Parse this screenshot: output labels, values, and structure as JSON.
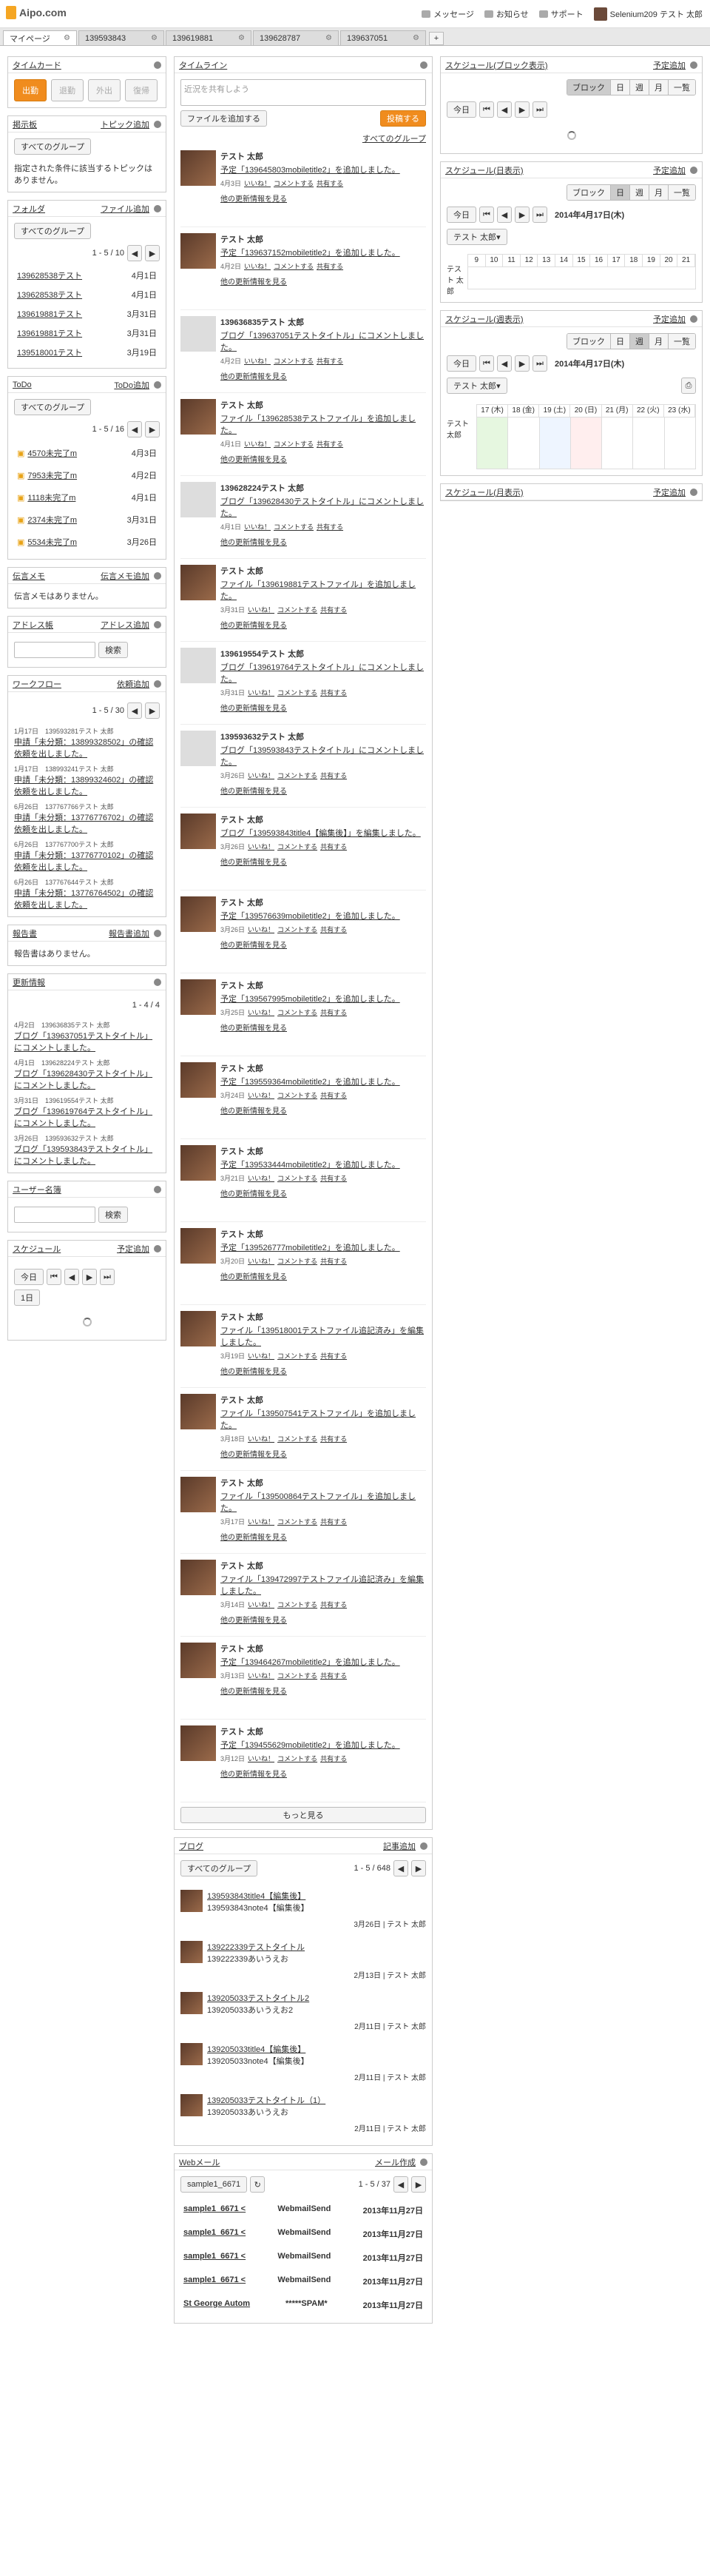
{
  "header": {
    "logo": "Aipo.com",
    "nav": [
      "メッセージ",
      "お知らせ",
      "サポート"
    ],
    "user": "Selenium209 テスト 太郎"
  },
  "tabs": [
    "マイページ",
    "139593843",
    "139619881",
    "139628787",
    "139637051"
  ],
  "left": {
    "timecard": {
      "title": "タイムカード",
      "buttons": [
        "出勤",
        "退勤",
        "外出",
        "復帰"
      ]
    },
    "topic": {
      "title": "掲示板",
      "action": "トピック追加",
      "group": "すべてのグループ",
      "empty": "指定された条件に該当するトピックはありません。"
    },
    "folder": {
      "title": "フォルダ",
      "action": "ファイル追加",
      "group": "すべてのグループ",
      "pager": "1 - 5 / 10",
      "items": [
        {
          "n": "139628538テスト",
          "d": "4月1日"
        },
        {
          "n": "139628538テスト",
          "d": "4月1日"
        },
        {
          "n": "139619881テスト",
          "d": "3月31日"
        },
        {
          "n": "139619881テスト",
          "d": "3月31日"
        },
        {
          "n": "139518001テスト",
          "d": "3月19日"
        }
      ]
    },
    "todo": {
      "title": "ToDo",
      "action": "ToDo追加",
      "group": "すべてのグループ",
      "pager": "1 - 5 / 16",
      "items": [
        {
          "n": "4570未完了m",
          "d": "4月3日"
        },
        {
          "n": "7953未完了m",
          "d": "4月2日"
        },
        {
          "n": "1118未完了m",
          "d": "4月1日"
        },
        {
          "n": "2374未完了m",
          "d": "3月31日"
        },
        {
          "n": "5534未完了m",
          "d": "3月26日"
        }
      ]
    },
    "memo": {
      "title": "伝言メモ",
      "action": "伝言メモ追加",
      "empty": "伝言メモはありません。"
    },
    "address": {
      "title": "アドレス帳",
      "action": "アドレス追加",
      "search": "検索"
    },
    "workflow": {
      "title": "ワークフロー",
      "action": "依頼追加",
      "pager": "1 - 5 / 30",
      "items": [
        {
          "m": "1月17日　139593281テスト 太郎",
          "t": "申請「未分類：13899328502」の確認依頼を出しました。"
        },
        {
          "m": "1月17日　138993241テスト 太郎",
          "t": "申請「未分類：13899324602」の確認依頼を出しました。"
        },
        {
          "m": "6月26日　137767766テスト 太郎",
          "t": "申請「未分類：13776776702」の確認依頼を出しました。"
        },
        {
          "m": "6月26日　137767700テスト 太郎",
          "t": "申請「未分類：13776770102」の確認依頼を出しました。"
        },
        {
          "m": "6月26日　137767644テスト 太郎",
          "t": "申請「未分類：13776764502」の確認依頼を出しました。"
        }
      ]
    },
    "report": {
      "title": "報告書",
      "action": "報告書追加",
      "empty": "報告書はありません。"
    },
    "updates": {
      "title": "更新情報",
      "pager": "1 - 4 / 4",
      "items": [
        {
          "m": "4月2日　139636835テスト 太郎",
          "t": "ブログ「139637051テストタイトル」にコメントしました。"
        },
        {
          "m": "4月1日　139628224テスト 太郎",
          "t": "ブログ「139628430テストタイトル」にコメントしました。"
        },
        {
          "m": "3月31日　139619554テスト 太郎",
          "t": "ブログ「139619764テストタイトル」にコメントしました。"
        },
        {
          "m": "3月26日　139593632テスト 太郎",
          "t": "ブログ「139593843テストタイトル」にコメントしました。"
        }
      ]
    },
    "users": {
      "title": "ユーザー名簿",
      "search": "検索"
    },
    "schedule": {
      "title": "スケジュール",
      "action": "予定追加",
      "today": "今日",
      "one": "1日"
    }
  },
  "middle": {
    "timeline": {
      "title": "タイムライン",
      "placeholder": "近況を共有しよう",
      "attach": "ファイルを追加する",
      "post": "投稿する",
      "group": "すべてのグループ",
      "more": "もっと見る",
      "items": [
        {
          "name": "テスト 太郎",
          "text": "予定「139645803mobiletitle2」を追加しました。",
          "date": "4月3日",
          "a": true
        },
        {
          "name": "テスト 太郎",
          "text": "予定「139637152mobiletitle2」を追加しました。",
          "date": "4月2日",
          "a": true
        },
        {
          "name": "139636835テスト 太郎",
          "text": "ブログ「139637051テストタイトル」にコメントしました。",
          "date": "4月2日",
          "a": false
        },
        {
          "name": "テスト 太郎",
          "text": "ファイル「139628538テストファイル」を追加しました。",
          "date": "4月1日",
          "a": true
        },
        {
          "name": "139628224テスト 太郎",
          "text": "ブログ「139628430テストタイトル」にコメントしました。",
          "date": "4月1日",
          "a": false
        },
        {
          "name": "テスト 太郎",
          "text": "ファイル「139619881テストファイル」を追加しました。",
          "date": "3月31日",
          "a": true
        },
        {
          "name": "139619554テスト 太郎",
          "text": "ブログ「139619764テストタイトル」にコメントしました。",
          "date": "3月31日",
          "a": false
        },
        {
          "name": "139593632テスト 太郎",
          "text": "ブログ「139593843テストタイトル」にコメントしました。",
          "date": "3月26日",
          "a": false
        },
        {
          "name": "テスト 太郎",
          "text": "ブログ「139593843title4【編集後】」を編集しました。",
          "date": "3月26日",
          "a": true
        },
        {
          "name": "テスト 太郎",
          "text": "予定「139576639mobiletitle2」を追加しました。",
          "date": "3月26日",
          "a": true
        },
        {
          "name": "テスト 太郎",
          "text": "予定「139567995mobiletitle2」を追加しました。",
          "date": "3月25日",
          "a": true
        },
        {
          "name": "テスト 太郎",
          "text": "予定「139559364mobiletitle2」を追加しました。",
          "date": "3月24日",
          "a": true
        },
        {
          "name": "テスト 太郎",
          "text": "予定「139533444mobiletitle2」を追加しました。",
          "date": "3月21日",
          "a": true
        },
        {
          "name": "テスト 太郎",
          "text": "予定「139526777mobiletitle2」を追加しました。",
          "date": "3月20日",
          "a": true
        },
        {
          "name": "テスト 太郎",
          "text": "ファイル「139518001テストファイル追記済み」を編集しました。",
          "date": "3月19日",
          "a": true
        },
        {
          "name": "テスト 太郎",
          "text": "ファイル「139507541テストファイル」を追加しました。",
          "date": "3月18日",
          "a": true
        },
        {
          "name": "テスト 太郎",
          "text": "ファイル「139500864テストファイル」を追加しました。",
          "date": "3月17日",
          "a": true
        },
        {
          "name": "テスト 太郎",
          "text": "ファイル「139472997テストファイル追記済み」を編集しました。",
          "date": "3月14日",
          "a": true
        },
        {
          "name": "テスト 太郎",
          "text": "予定「139464267mobiletitle2」を追加しました。",
          "date": "3月13日",
          "a": true
        },
        {
          "name": "テスト 太郎",
          "text": "予定「139455629mobiletitle2」を追加しました。",
          "date": "3月12日",
          "a": true
        }
      ],
      "like": "いいね！",
      "comment": "コメントする",
      "share": "共有する",
      "update_more": "他の更新情報を見る"
    },
    "blog": {
      "title": "ブログ",
      "action": "記事追加",
      "group": "すべてのグループ",
      "pager": "1 - 5 / 648",
      "items": [
        {
          "t": "139593843title4【編集後】",
          "b": "139593843note4【編集後】",
          "f": "3月26日 | テスト 太郎"
        },
        {
          "t": "139222339テストタイトル",
          "b": "139222339あいうえお",
          "f": "2月13日 | テスト 太郎"
        },
        {
          "t": "139205033テストタイトル2",
          "b": "139205033あいうえお2",
          "f": "2月11日 | テスト 太郎"
        },
        {
          "t": "139205033title4【編集後】",
          "b": "139205033note4【編集後】",
          "f": "2月11日 | テスト 太郎"
        },
        {
          "t": "139205033テストタイトル（1）",
          "b": "139205033あいうえお",
          "f": "2月11日 | テスト 太郎"
        }
      ]
    },
    "webmail": {
      "title": "Webメール",
      "action": "メール作成",
      "account": "sample1_6671",
      "pager": "1 - 5 / 37",
      "items": [
        {
          "f": "sample1_6671 <",
          "s": "WebmailSend",
          "d": "2013年11月27日"
        },
        {
          "f": "sample1_6671 <",
          "s": "WebmailSend",
          "d": "2013年11月27日"
        },
        {
          "f": "sample1_6671 <",
          "s": "WebmailSend",
          "d": "2013年11月27日"
        },
        {
          "f": "sample1_6671 <",
          "s": "WebmailSend",
          "d": "2013年11月27日"
        },
        {
          "f": "St George Autom",
          "s": "*****SPAM*",
          "d": "2013年11月27日"
        }
      ]
    }
  },
  "right": {
    "sblock": {
      "title": "スケジュール(ブロック表示)",
      "action": "予定追加",
      "views": [
        "ブロック",
        "日",
        "週",
        "月",
        "一覧"
      ],
      "today": "今日"
    },
    "sday": {
      "title": "スケジュール(日表示)",
      "action": "予定追加",
      "views": [
        "ブロック",
        "日",
        "週",
        "月",
        "一覧"
      ],
      "today": "今日",
      "date": "2014年4月17日(木)",
      "user": "テスト 太郎",
      "hours": [
        "9",
        "10",
        "11",
        "12",
        "13",
        "14",
        "15",
        "16",
        "17",
        "18",
        "19",
        "20",
        "21"
      ],
      "rowlabel": "テスト 太郎"
    },
    "sweek": {
      "title": "スケジュール(週表示)",
      "action": "予定追加",
      "views": [
        "ブロック",
        "日",
        "週",
        "月",
        "一覧"
      ],
      "today": "今日",
      "date": "2014年4月17日(木)",
      "user": "テスト 太郎",
      "days": [
        "17 (木)",
        "18 (金)",
        "19 (土)",
        "20 (日)",
        "21 (月)",
        "22 (火)",
        "23 (水)"
      ],
      "rowlabel": "テスト 太郎"
    },
    "smonth": {
      "title": "スケジュール(月表示)",
      "action": "予定追加"
    }
  }
}
